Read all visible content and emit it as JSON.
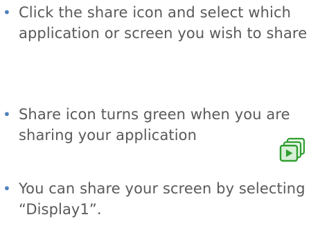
{
  "bullets": [
    {
      "text": "Click the share icon and select which application or screen you wish to share"
    },
    {
      "text": "Share icon turns green when you are sharing your application"
    },
    {
      "text": "You can share your screen by selecting “Display1”."
    }
  ],
  "icons": {
    "share_icon": "share-screen-icon",
    "share_icon_color": "#2e8b2e"
  },
  "colors": {
    "bullet": "#4f81bd",
    "text": "#595959",
    "icon_green": "#3aa83a"
  }
}
